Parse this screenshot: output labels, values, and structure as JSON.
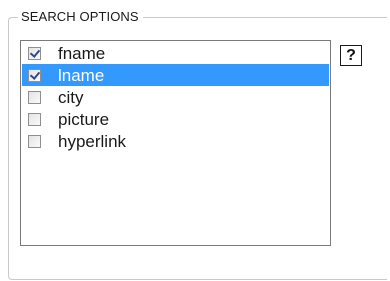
{
  "panel": {
    "legend": "SEARCH OPTIONS"
  },
  "options": [
    {
      "label": "fname",
      "checked": true,
      "selected": false
    },
    {
      "label": "lname",
      "checked": true,
      "selected": true
    },
    {
      "label": "city",
      "checked": false,
      "selected": false
    },
    {
      "label": "picture",
      "checked": false,
      "selected": false
    },
    {
      "label": "hyperlink",
      "checked": false,
      "selected": false
    }
  ],
  "help": {
    "label": "?"
  },
  "colors": {
    "selection": "#3399ff",
    "border": "#7a7a7a"
  }
}
